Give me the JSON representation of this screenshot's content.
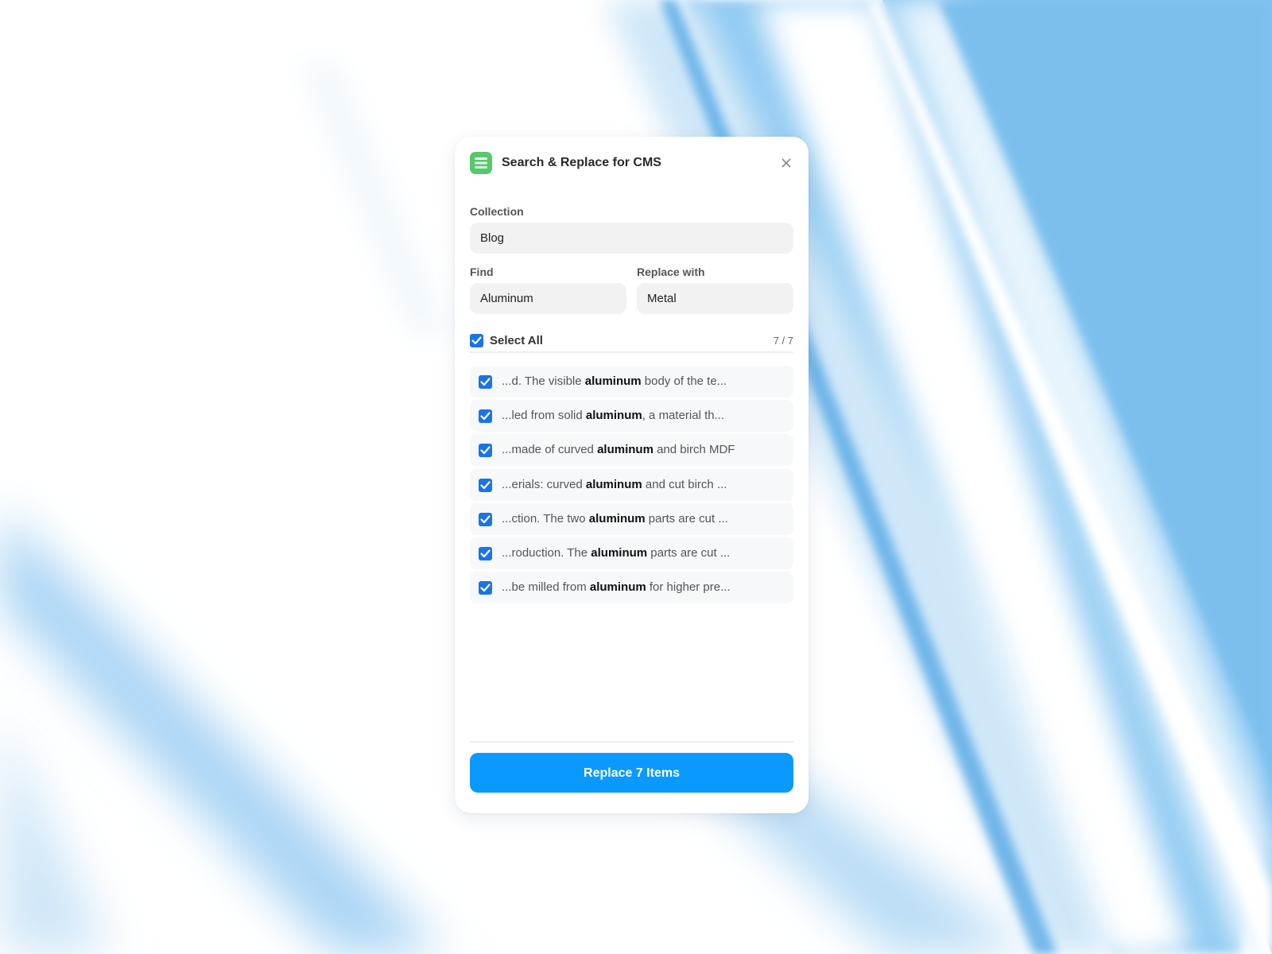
{
  "dialog": {
    "title": "Search & Replace for CMS",
    "collection": {
      "label": "Collection",
      "value": "Blog"
    },
    "find": {
      "label": "Find",
      "value": "Aluminum"
    },
    "replace": {
      "label": "Replace with",
      "value": "Metal"
    },
    "select_all": {
      "label": "Select All",
      "checked": true,
      "count": "7 / 7"
    },
    "results": [
      {
        "before": "...d. The visible ",
        "match": "aluminum",
        "after": " body of the te...",
        "checked": true
      },
      {
        "before": "...led from solid ",
        "match": "aluminum",
        "after": ", a material th...",
        "checked": true
      },
      {
        "before": "...made of curved ",
        "match": "aluminum",
        "after": " and birch MDF",
        "checked": true
      },
      {
        "before": "...erials: curved ",
        "match": "aluminum",
        "after": " and cut birch ...",
        "checked": true
      },
      {
        "before": "...ction. The two ",
        "match": "aluminum",
        "after": " parts are cut ...",
        "checked": true
      },
      {
        "before": "...roduction. The ",
        "match": "aluminum",
        "after": " parts are cut ...",
        "checked": true
      },
      {
        "before": "...be milled from ",
        "match": "aluminum",
        "after": " for higher pre...",
        "checked": true
      }
    ],
    "action_button": "Replace 7 Items"
  },
  "icons": {
    "app": "stacked-layers-icon",
    "close": "close-icon",
    "check": "check-icon"
  },
  "colors": {
    "accent": "#0a99ff",
    "checkbox": "#1a73e8",
    "app_icon": "#56c96a",
    "background_blue": "#7fc0ee"
  }
}
